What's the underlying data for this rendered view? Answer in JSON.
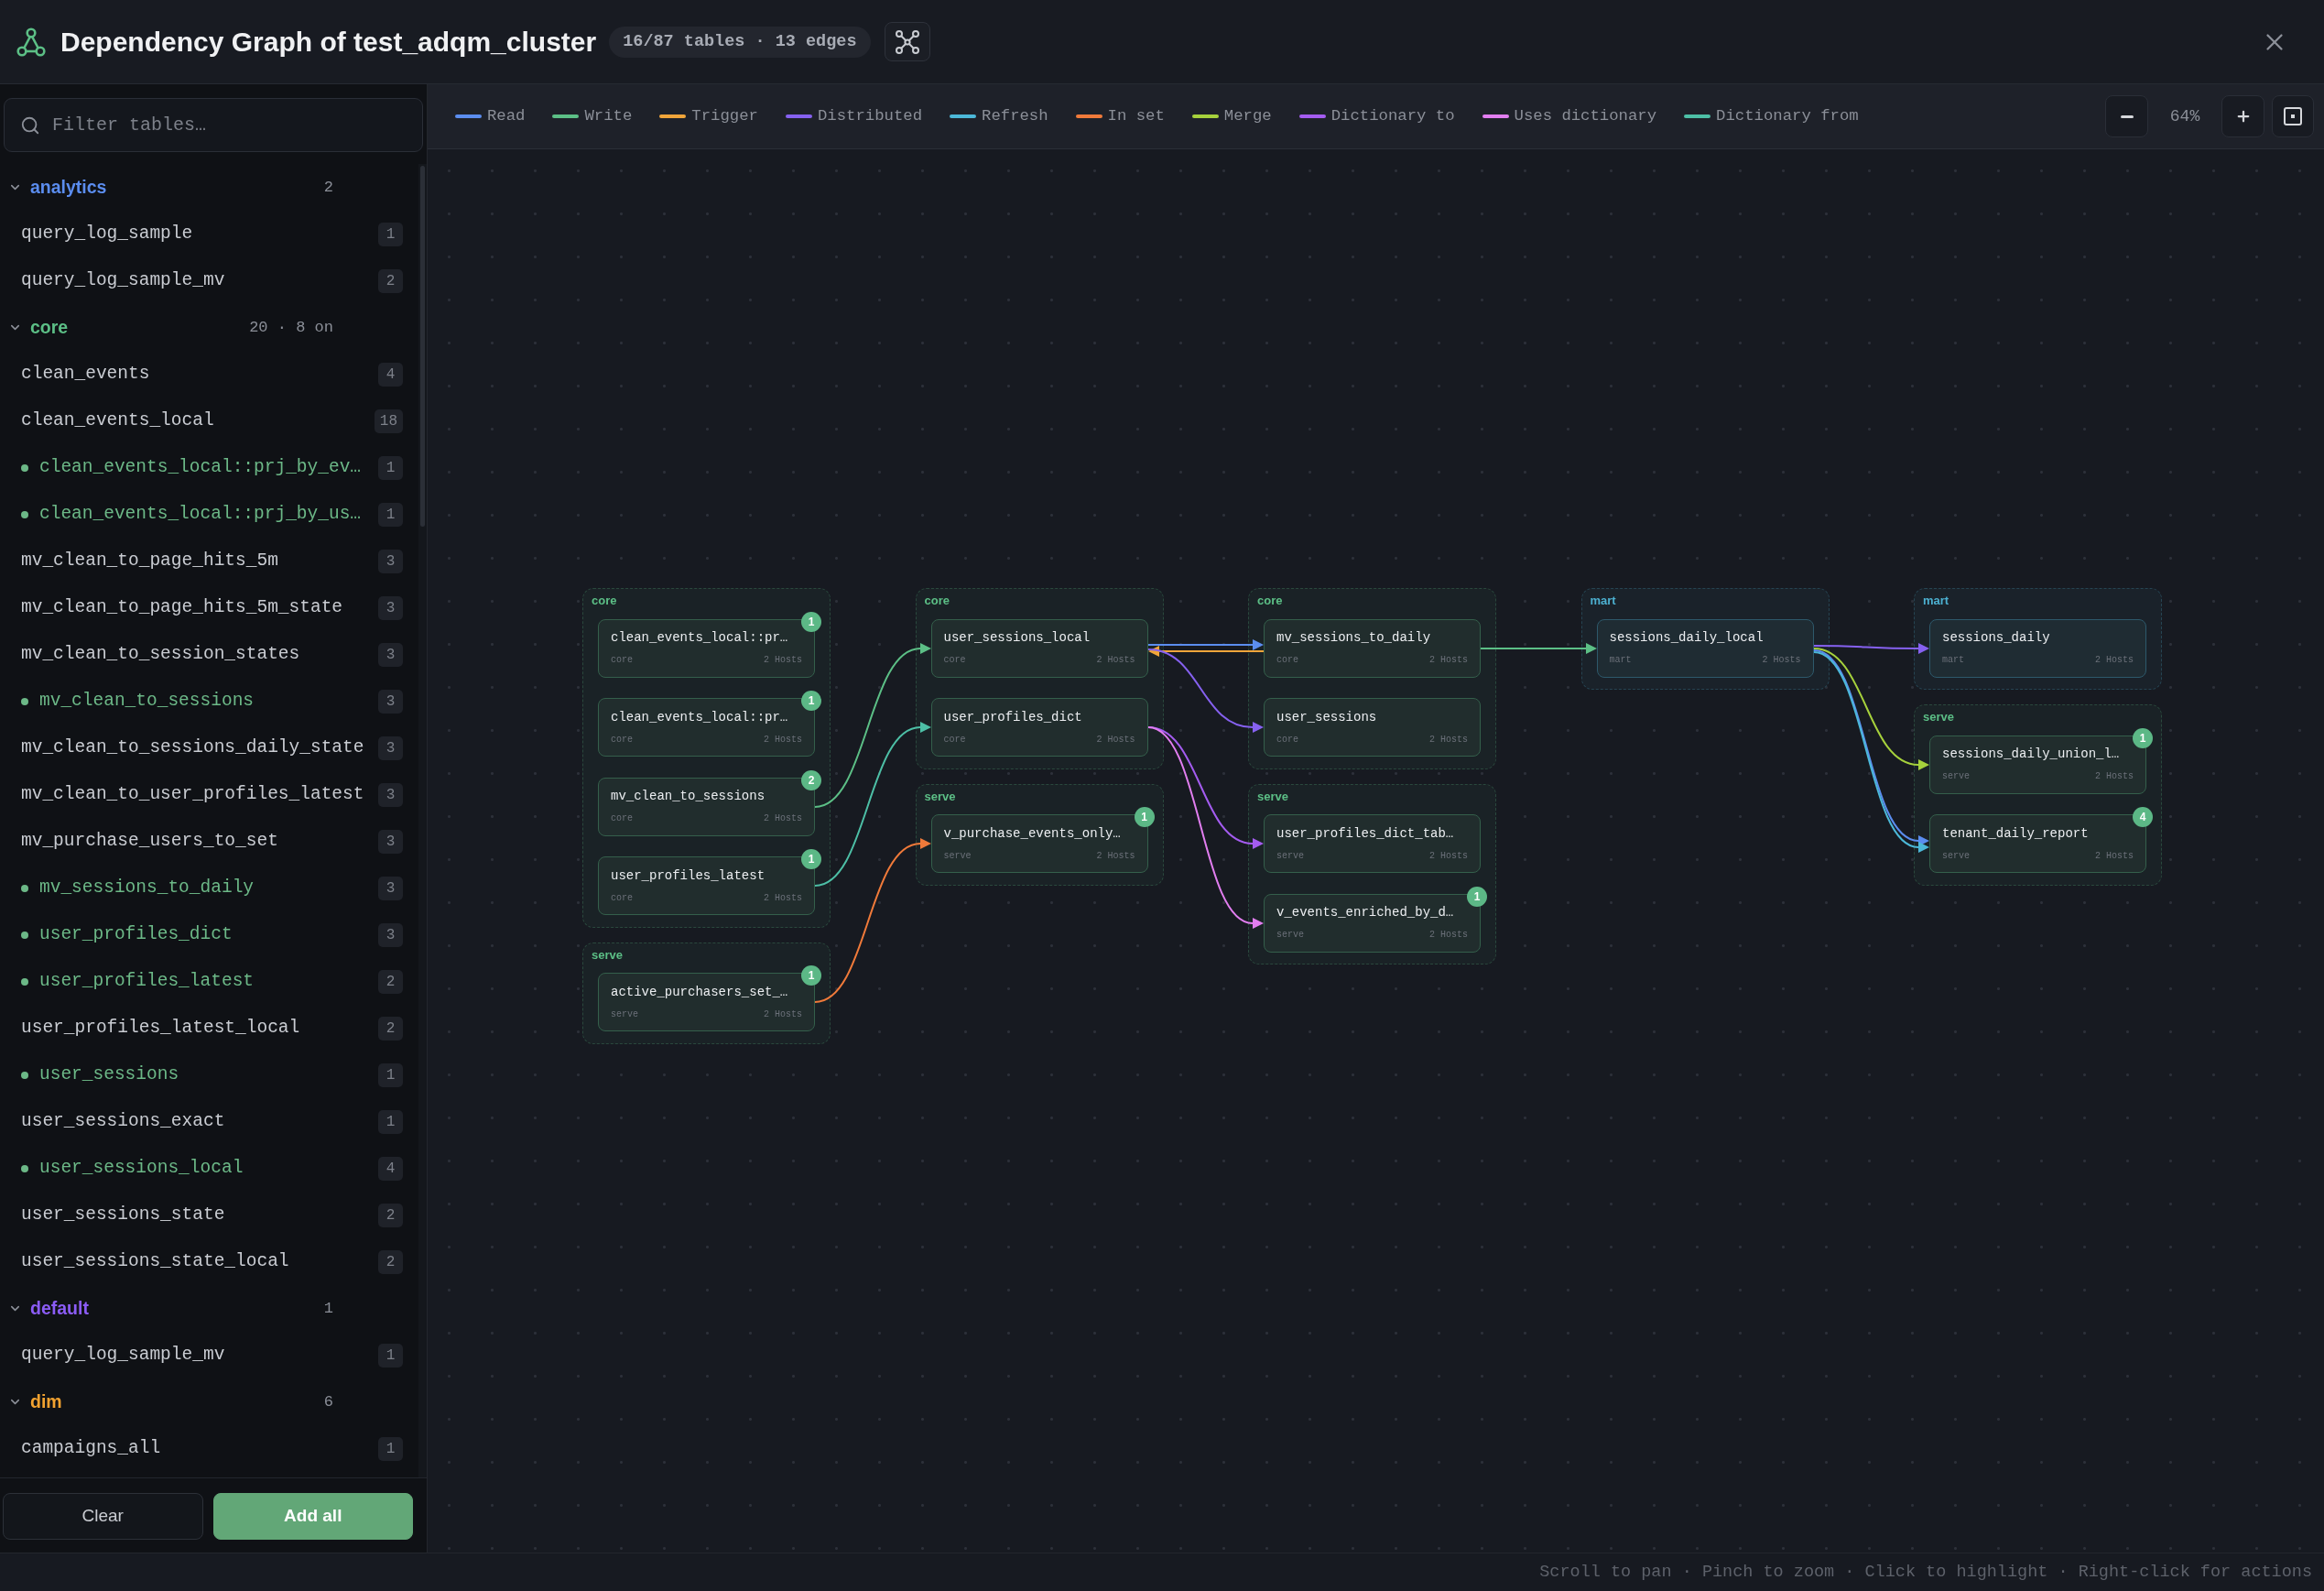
{
  "header": {
    "title": "Dependency Graph of test_adqm_cluster",
    "stats": "16/87 tables · 13 edges"
  },
  "sidebar": {
    "filter": {
      "placeholder": "Filter tables…"
    },
    "schemas": [
      {
        "name": "analytics",
        "color": "#5b8def",
        "count": "2",
        "expanded": true,
        "tables": [
          {
            "name": "query_log_sample",
            "count": "1",
            "on": false
          },
          {
            "name": "query_log_sample_mv",
            "count": "2",
            "on": false
          }
        ]
      },
      {
        "name": "core",
        "color": "#5cbf86",
        "count": "20 · 8 on",
        "expanded": true,
        "tables": [
          {
            "name": "clean_events",
            "count": "4",
            "on": false
          },
          {
            "name": "clean_events_local",
            "count": "18",
            "on": false
          },
          {
            "name": "clean_events_local::prj_by_ev…",
            "count": "1",
            "on": true
          },
          {
            "name": "clean_events_local::prj_by_us…",
            "count": "1",
            "on": true
          },
          {
            "name": "mv_clean_to_page_hits_5m",
            "count": "3",
            "on": false
          },
          {
            "name": "mv_clean_to_page_hits_5m_state",
            "count": "3",
            "on": false
          },
          {
            "name": "mv_clean_to_session_states",
            "count": "3",
            "on": false
          },
          {
            "name": "mv_clean_to_sessions",
            "count": "3",
            "on": true
          },
          {
            "name": "mv_clean_to_sessions_daily_state",
            "count": "3",
            "on": false
          },
          {
            "name": "mv_clean_to_user_profiles_latest",
            "count": "3",
            "on": false
          },
          {
            "name": "mv_purchase_users_to_set",
            "count": "3",
            "on": false
          },
          {
            "name": "mv_sessions_to_daily",
            "count": "3",
            "on": true
          },
          {
            "name": "user_profiles_dict",
            "count": "3",
            "on": true
          },
          {
            "name": "user_profiles_latest",
            "count": "2",
            "on": true
          },
          {
            "name": "user_profiles_latest_local",
            "count": "2",
            "on": false
          },
          {
            "name": "user_sessions",
            "count": "1",
            "on": true
          },
          {
            "name": "user_sessions_exact",
            "count": "1",
            "on": false
          },
          {
            "name": "user_sessions_local",
            "count": "4",
            "on": true
          },
          {
            "name": "user_sessions_state",
            "count": "2",
            "on": false
          },
          {
            "name": "user_sessions_state_local",
            "count": "2",
            "on": false
          }
        ]
      },
      {
        "name": "default",
        "color": "#8b5cf6",
        "count": "1",
        "expanded": true,
        "tables": [
          {
            "name": "query_log_sample_mv",
            "count": "1",
            "on": false
          }
        ]
      },
      {
        "name": "dim",
        "color": "#f2a230",
        "count": "6",
        "expanded": true,
        "tables": [
          {
            "name": "campaigns_all",
            "count": "1",
            "on": false
          }
        ]
      }
    ],
    "buttons": [
      {
        "label": "Clear",
        "kind": "secondary"
      },
      {
        "label": "Add all",
        "kind": "primary"
      }
    ]
  },
  "legend": [
    {
      "label": "Read",
      "color": "#5b8def"
    },
    {
      "label": "Write",
      "color": "#5cbf86"
    },
    {
      "label": "Trigger",
      "color": "#f0a53a"
    },
    {
      "label": "Distributed",
      "color": "#8661f0"
    },
    {
      "label": "Refresh",
      "color": "#4cb8d8"
    },
    {
      "label": "In set",
      "color": "#f07a3a"
    },
    {
      "label": "Merge",
      "color": "#a6d13c"
    },
    {
      "label": "Dictionary to",
      "color": "#a45cf0"
    },
    {
      "label": "Uses dictionary",
      "color": "#e27ef0"
    },
    {
      "label": "Dictionary from",
      "color": "#4dbfa6"
    }
  ],
  "zoom": {
    "value": "64%"
  },
  "graph": {
    "columns": [
      {
        "groups": [
          {
            "schema": "core",
            "color": "#5cbf86",
            "nodes": [
              {
                "name": "clean_events_local::pr…",
                "schema": "core",
                "hosts": "2 Hosts",
                "badge": "1"
              },
              {
                "name": "clean_events_local::pr…",
                "schema": "core",
                "hosts": "2 Hosts",
                "badge": "1"
              },
              {
                "name": "mv_clean_to_sessions",
                "schema": "core",
                "hosts": "2 Hosts",
                "badge": "2"
              },
              {
                "name": "user_profiles_latest",
                "schema": "core",
                "hosts": "2 Hosts",
                "badge": "1"
              }
            ]
          },
          {
            "schema": "serve",
            "color": "#5cbf86",
            "nodes": [
              {
                "name": "active_purchasers_set_…",
                "schema": "serve",
                "hosts": "2 Hosts",
                "badge": "1"
              }
            ]
          }
        ]
      },
      {
        "groups": [
          {
            "schema": "core",
            "color": "#5cbf86",
            "nodes": [
              {
                "name": "user_sessions_local",
                "schema": "core",
                "hosts": "2 Hosts"
              },
              {
                "name": "user_profiles_dict",
                "schema": "core",
                "hosts": "2 Hosts"
              }
            ]
          },
          {
            "schema": "serve",
            "color": "#5cbf86",
            "nodes": [
              {
                "name": "v_purchase_events_only…",
                "schema": "serve",
                "hosts": "2 Hosts",
                "badge": "1"
              }
            ]
          }
        ]
      },
      {
        "groups": [
          {
            "schema": "core",
            "color": "#5cbf86",
            "nodes": [
              {
                "name": "mv_sessions_to_daily",
                "schema": "core",
                "hosts": "2 Hosts"
              },
              {
                "name": "user_sessions",
                "schema": "core",
                "hosts": "2 Hosts"
              }
            ]
          },
          {
            "schema": "serve",
            "color": "#5cbf86",
            "nodes": [
              {
                "name": "user_profiles_dict_tab…",
                "schema": "serve",
                "hosts": "2 Hosts"
              },
              {
                "name": "v_events_enriched_by_d…",
                "schema": "serve",
                "hosts": "2 Hosts",
                "badge": "1"
              }
            ]
          }
        ]
      },
      {
        "groups": [
          {
            "schema": "mart",
            "color": "#4cb0d0",
            "nodes": [
              {
                "name": "sessions_daily_local",
                "schema": "mart",
                "hosts": "2 Hosts"
              }
            ]
          }
        ]
      },
      {
        "groups": [
          {
            "schema": "mart",
            "color": "#4cb0d0",
            "nodes": [
              {
                "name": "sessions_daily",
                "schema": "mart",
                "hosts": "2 Hosts"
              }
            ]
          },
          {
            "schema": "serve",
            "color": "#5cbf86",
            "nodes": [
              {
                "name": "sessions_daily_union_l…",
                "schema": "serve",
                "hosts": "2 Hosts",
                "badge": "1"
              },
              {
                "name": "tenant_daily_report",
                "schema": "serve",
                "hosts": "2 Hosts",
                "badge": "4"
              }
            ]
          }
        ]
      }
    ],
    "edges": [
      {
        "color": "#5cbf86"
      },
      {
        "color": "#4dbfa6"
      },
      {
        "color": "#f07a3a"
      },
      {
        "color": "#5b8def"
      },
      {
        "color": "#f0a53a"
      },
      {
        "color": "#8661f0"
      },
      {
        "color": "#a45cf0"
      },
      {
        "color": "#e27ef0"
      },
      {
        "color": "#5cbf86"
      },
      {
        "color": "#8661f0"
      },
      {
        "color": "#a6d13c"
      },
      {
        "color": "#5b8def"
      },
      {
        "color": "#4cb8d8"
      }
    ]
  },
  "status_bar": "Scroll to pan · Pinch to zoom · Click to highlight · Right-click for actions"
}
